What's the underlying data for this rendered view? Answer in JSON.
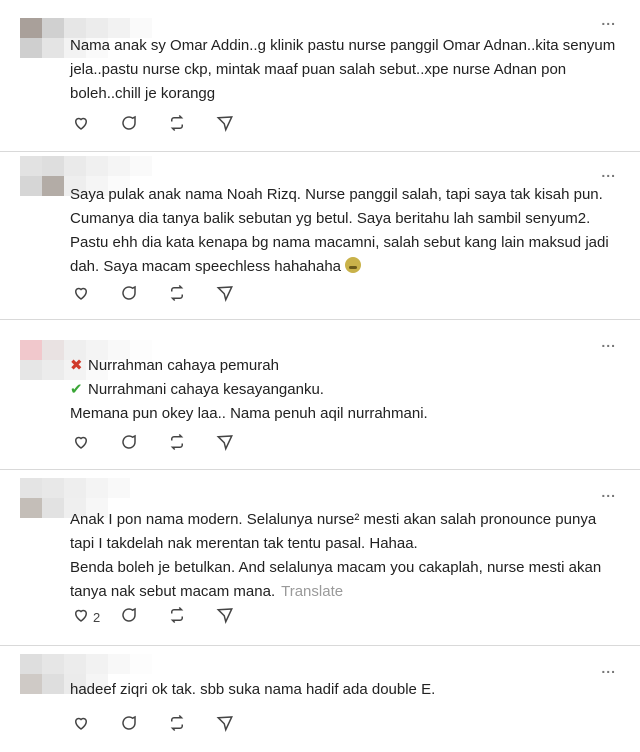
{
  "more_label": "...",
  "comments": [
    {
      "lines": [
        "Nama anak sy Omar Addin..g klinik pastu nurse panggil Omar Adnan..kita senyum",
        "jela..pastu nurse ckp, mintak maaf puan salah sebut..xpe nurse Adnan pon",
        "boleh..chill je korangg"
      ],
      "like_count": ""
    },
    {
      "lines": [
        "Saya pulak anak nama Noah Rizq. Nurse panggil salah, tapi saya tak kisah pun.",
        "Cumanya dia tanya balik sebutan yg betul. Saya beritahu lah sambil senyum2.",
        "Pastu ehh dia kata kenapa bg nama macamni, salah sebut kang lain maksud jadi",
        "dah. Saya macam speechless hahahaha"
      ],
      "emoji_icon": "laughing-crying-emoji",
      "like_count": ""
    },
    {
      "wrong_mark": "✖",
      "wrong_text": "Nurrahman cahaya pemurah",
      "right_mark": "✔",
      "right_text": "Nurrahmani cahaya kesayanganku.",
      "lines": [
        "Memana pun okey laa.. Nama penuh aqil nurrahmani."
      ],
      "like_count": ""
    },
    {
      "lines": [
        "Anak I pon nama modern. Selalunya nurse² mesti akan salah pronounce punya",
        "tapi I takdelah nak merentan tak tentu pasal. Hahaa.",
        "Benda boleh je betulkan. And selalunya macam you cakaplah, nurse mesti akan",
        "tanya nak sebut macam mana."
      ],
      "translate_label": "Translate",
      "like_count": "2"
    },
    {
      "lines": [
        "hadeef ziqri ok tak. sbb suka nama hadif ada double E."
      ],
      "like_count": ""
    }
  ],
  "icons": {
    "like": "heart-icon",
    "reply": "comment-icon",
    "repost": "repost-icon",
    "share": "send-icon"
  },
  "colors": {
    "text": "#222222",
    "muted": "#9a9a9a",
    "wrong": "#d03a2a",
    "right": "#3aa636",
    "divider": "#d9d9d9"
  }
}
